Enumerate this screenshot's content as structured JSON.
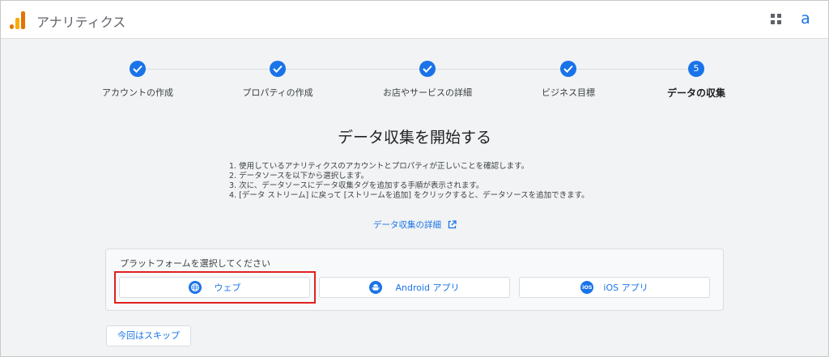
{
  "app": {
    "title": "アナリティクス",
    "avatar_letter": "a"
  },
  "colors": {
    "accent": "#1a73e8",
    "logo_dark": "#e37400",
    "logo_light": "#f9ab00",
    "highlight": "#e02020"
  },
  "stepper": {
    "steps": [
      {
        "label": "アカウントの作成",
        "state": "done",
        "icon": "check-icon"
      },
      {
        "label": "プロパティの作成",
        "state": "done",
        "icon": "check-icon"
      },
      {
        "label": "お店やサービスの詳細",
        "state": "done",
        "icon": "check-icon"
      },
      {
        "label": "ビジネス目標",
        "state": "done",
        "icon": "check-icon"
      },
      {
        "label": "データの収集",
        "state": "active",
        "number": "5"
      }
    ]
  },
  "main": {
    "heading": "データ収集を開始する",
    "instructions": [
      "1. 使用しているアナリティクスのアカウントとプロパティが正しいことを確認します。",
      "2. データソースを以下から選択します。",
      "3. 次に、データソースにデータ収集タグを追加する手順が表示されます。",
      "4. [データ ストリーム] に戻って [ストリームを追加] をクリックすると、データソースを追加できます。"
    ],
    "learn_more": "データ収集の詳細",
    "platform_title": "プラットフォームを選択してください",
    "platforms": [
      {
        "label": "ウェブ",
        "icon": "globe-icon"
      },
      {
        "label": "Android アプリ",
        "icon": "android-icon"
      },
      {
        "label": "iOS アプリ",
        "icon": "ios-icon",
        "badge": "iOS"
      }
    ],
    "skip_label": "今回はスキップ"
  }
}
